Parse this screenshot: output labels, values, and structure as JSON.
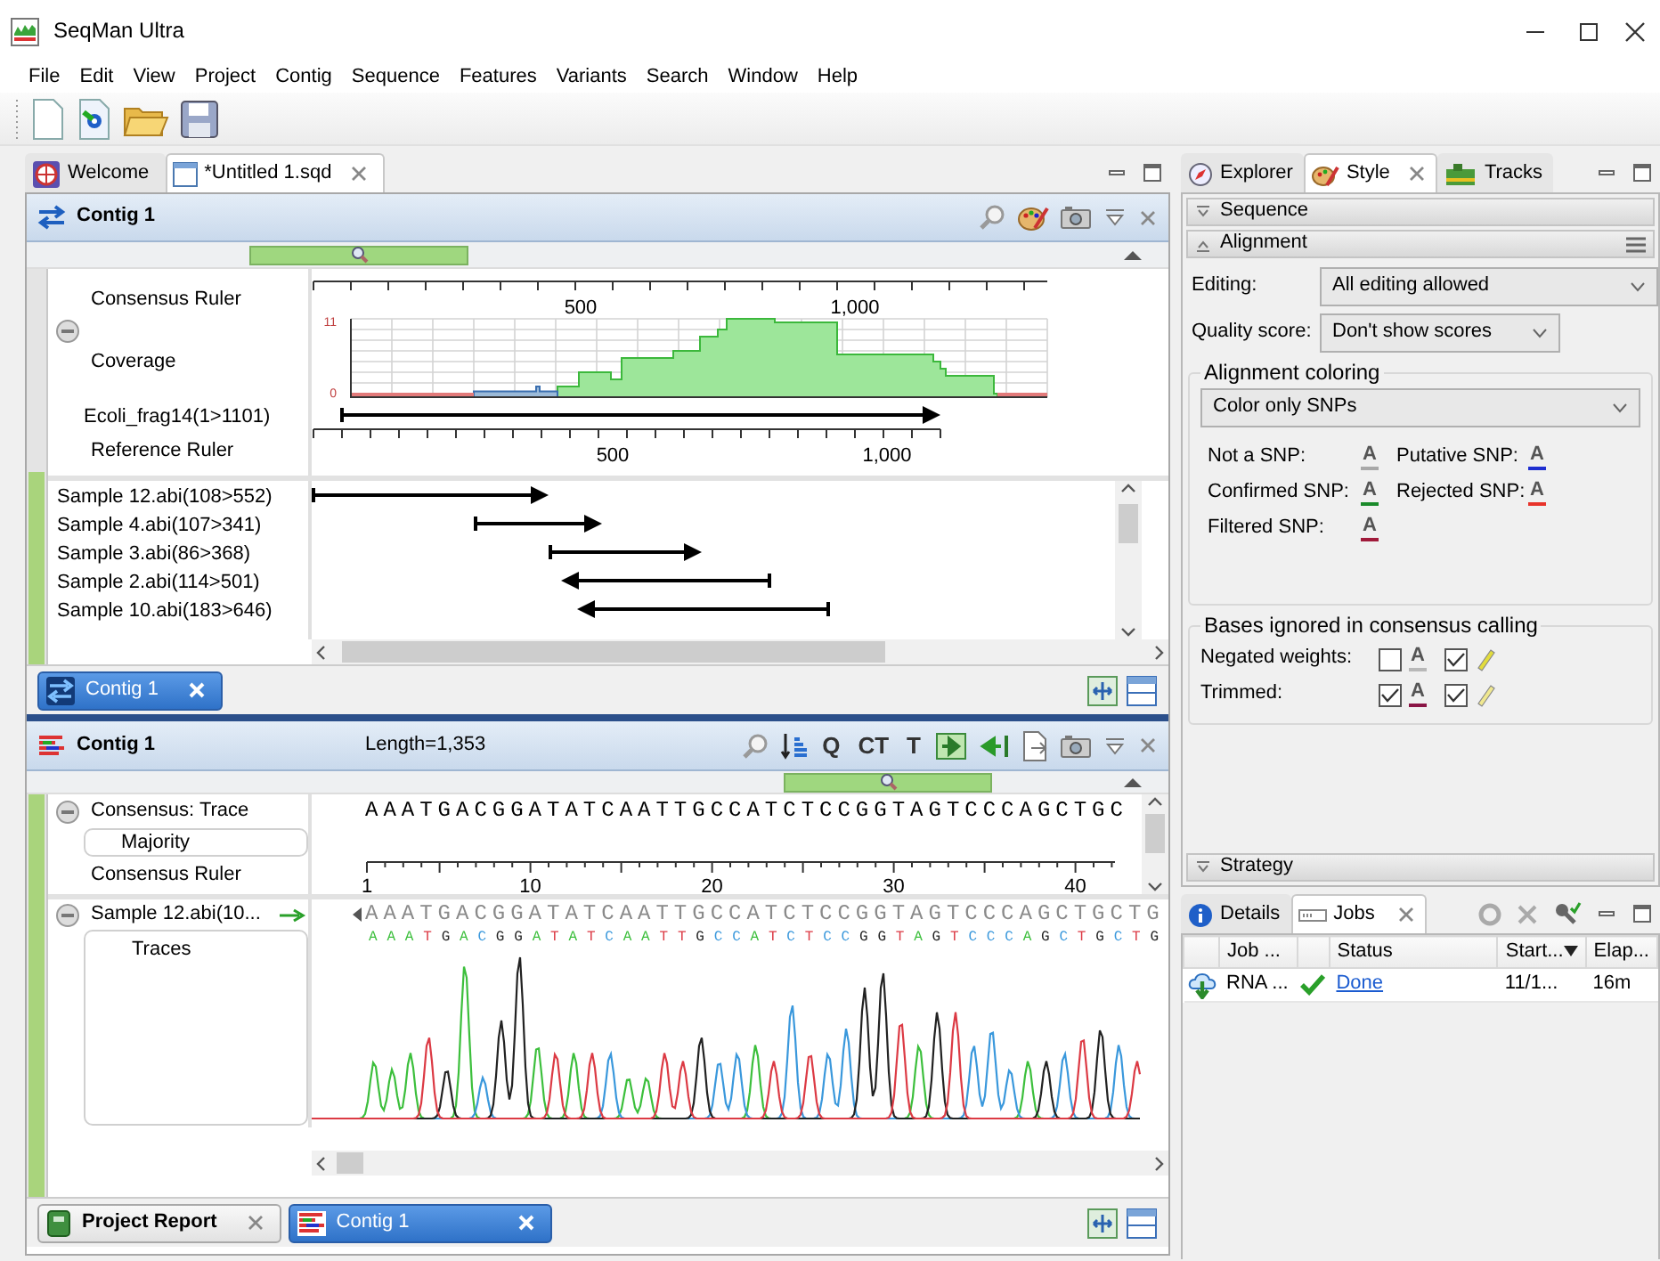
{
  "window": {
    "title": "SeqMan Ultra"
  },
  "menu": [
    "File",
    "Edit",
    "View",
    "Project",
    "Contig",
    "Sequence",
    "Features",
    "Variants",
    "Search",
    "Window",
    "Help"
  ],
  "editor_tabs": [
    {
      "label": "Welcome",
      "kind": "welcome",
      "selected": false,
      "closable": false
    },
    {
      "label": "*Untitled 1.sqd",
      "kind": "document",
      "selected": true,
      "closable": true
    }
  ],
  "overview_panel": {
    "title": "Contig 1",
    "tracks": [
      "Consensus Ruler",
      "Coverage",
      "Ecoli_frag14(1>1101)",
      "Reference Ruler"
    ],
    "consensus_ruler_labels": [
      "500",
      "1,000"
    ],
    "coverage_labels": [
      "11",
      "0"
    ],
    "reference_ruler_labels": [
      "500",
      "1,000"
    ],
    "overview": {
      "level": 0.2
    },
    "reads": [
      {
        "label": "Sample 12.abi(108>552)",
        "kind": "forward"
      },
      {
        "label": "Sample 4.abi(107>341)",
        "kind": "forward"
      },
      {
        "label": "Sample 3.abi(86>368)",
        "kind": "forward"
      },
      {
        "label": "Sample 2.abi(114>501)",
        "kind": "reverse"
      },
      {
        "label": "Sample 10.abi(183>646)",
        "kind": "reverse"
      }
    ],
    "tabs": [
      {
        "label": "Contig 1",
        "selected": true
      }
    ]
  },
  "alignment_panel": {
    "title": "Contig 1",
    "length": "Length=1,353",
    "tool_letters": [
      "Q",
      "CT",
      "T"
    ],
    "consensus": {
      "label": "Consensus: Trace",
      "sequence": "AAATGACGGATATCAATTGCCATCTCCGGTAGTCCCAGCTGC",
      "mode": "Majority"
    },
    "ruler": {
      "label": "Consensus Ruler",
      "ticks": [
        "1",
        "10",
        "20",
        "30",
        "40"
      ]
    },
    "sample": {
      "label": "Sample 12.abi(10...",
      "sequence": "AAATGACGGATATCAATTGCCATCTCCGGTAGTCCCAGCTGCTG",
      "trace_label": "Traces",
      "trace_bases": "AAATGACGGATATCAATTGCCATCTCCGGTAGTCCCAGCTGCTG"
    }
  },
  "bottom_tabs": [
    {
      "label": "Project Report",
      "kind": "report",
      "selected": false
    },
    {
      "label": "Contig 1",
      "kind": "contig",
      "selected": true
    }
  ],
  "side_tabs": [
    {
      "label": "Explorer",
      "kind": "explorer",
      "selected": false
    },
    {
      "label": "Style",
      "kind": "style",
      "selected": true
    },
    {
      "label": "Tracks",
      "kind": "tracks",
      "selected": false
    }
  ],
  "sections": [
    {
      "label": "Sequence",
      "expanded": false
    },
    {
      "label": "Alignment",
      "expanded": true
    }
  ],
  "editing": {
    "label": "Editing:",
    "value": "All editing allowed"
  },
  "quality": {
    "label": "Quality score:",
    "value": "Don't show scores"
  },
  "coloring": {
    "legend": "Alignment coloring",
    "value": "Color only SNPs",
    "snps": [
      {
        "label": "Not a SNP:",
        "glyph": "A",
        "color": "#a8a8a8"
      },
      {
        "label": "Putative SNP:",
        "glyph": "A",
        "color": "#1f2fd0"
      },
      {
        "label": "Confirmed SNP:",
        "glyph": "A",
        "color": "#1a8a2a"
      },
      {
        "label": "Rejected SNP:",
        "glyph": "A",
        "color": "#e8332a"
      },
      {
        "label": "Filtered SNP:",
        "glyph": "A",
        "color": "#a01a3a"
      }
    ]
  },
  "ignored": {
    "legend": "Bases ignored in consensus calling",
    "rows": [
      {
        "label": "Negated weights:",
        "items": [
          {
            "kind": "base",
            "checked": false,
            "glyph": "A",
            "color": "#b8b8b8"
          },
          {
            "kind": "highlight",
            "checked": true,
            "color": "#e2dc3c"
          }
        ]
      },
      {
        "label": "Trimmed:",
        "items": [
          {
            "kind": "base",
            "checked": true,
            "glyph": "A",
            "color": "#8a1545"
          },
          {
            "kind": "highlight",
            "checked": true,
            "color": "#f0e890"
          }
        ]
      }
    ]
  },
  "strategy": {
    "label": "Strategy",
    "expanded": false
  },
  "job_tabs": [
    {
      "label": "Details",
      "kind": "details",
      "selected": false
    },
    {
      "label": "Jobs",
      "kind": "jobs",
      "selected": true
    }
  ],
  "jobs": {
    "columns": [
      "Job ...",
      "Status",
      "Start...",
      "Elap..."
    ],
    "rows": [
      {
        "name": "RNA ...",
        "done": true,
        "status": "Done",
        "start": "11/1...",
        "elapsed": "16m"
      }
    ]
  }
}
